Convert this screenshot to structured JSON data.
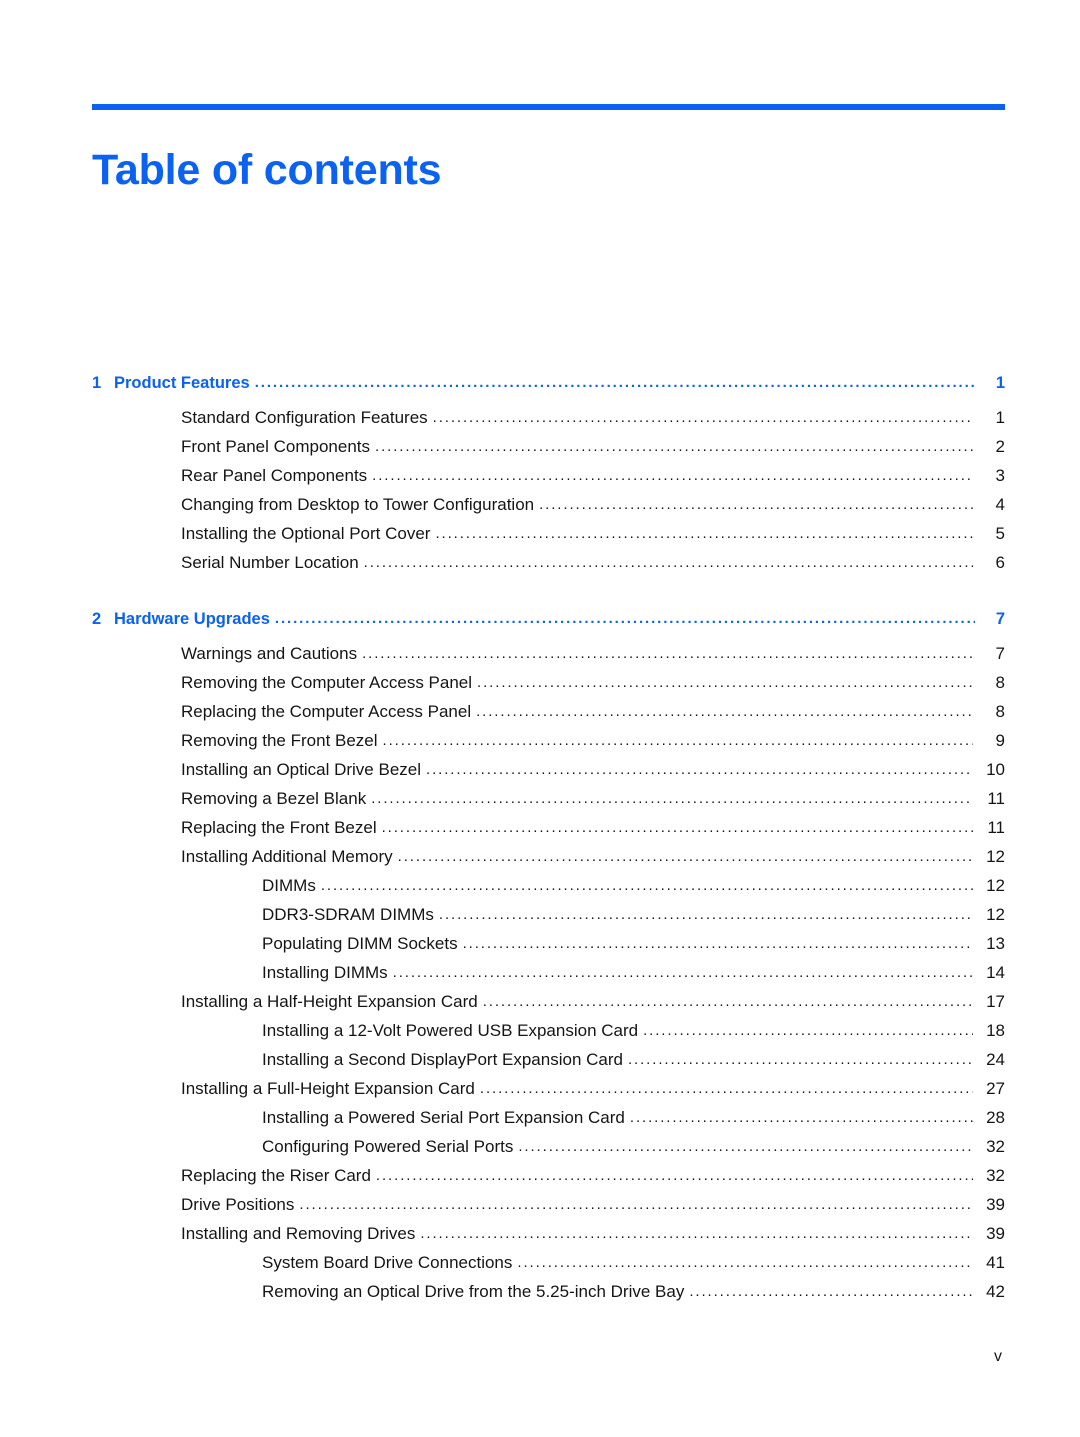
{
  "document": {
    "title": "Table of contents",
    "accent_color": "#0a62ef",
    "text_color": "#151515",
    "folio": "v"
  },
  "toc": {
    "leader_char": "............................................................................................................................................................................",
    "entries": [
      {
        "level": 1,
        "number": "1",
        "label": "Product Features",
        "page": "1"
      },
      {
        "level": 2,
        "number": "",
        "label": "Standard Configuration Features",
        "page": "1"
      },
      {
        "level": 2,
        "number": "",
        "label": "Front Panel Components",
        "page": "2"
      },
      {
        "level": 2,
        "number": "",
        "label": "Rear Panel Components",
        "page": "3"
      },
      {
        "level": 2,
        "number": "",
        "label": "Changing from Desktop to Tower Configuration",
        "page": "4"
      },
      {
        "level": 2,
        "number": "",
        "label": "Installing the Optional Port Cover",
        "page": "5"
      },
      {
        "level": 2,
        "number": "",
        "label": "Serial Number Location",
        "page": "6"
      },
      {
        "level": 1,
        "number": "2",
        "label": "Hardware Upgrades",
        "page": "7"
      },
      {
        "level": 2,
        "number": "",
        "label": "Warnings and Cautions",
        "page": "7"
      },
      {
        "level": 2,
        "number": "",
        "label": "Removing the Computer Access Panel",
        "page": "8"
      },
      {
        "level": 2,
        "number": "",
        "label": "Replacing the Computer Access Panel",
        "page": "8"
      },
      {
        "level": 2,
        "number": "",
        "label": "Removing the Front Bezel",
        "page": "9"
      },
      {
        "level": 2,
        "number": "",
        "label": "Installing an Optical Drive Bezel",
        "page": "10"
      },
      {
        "level": 2,
        "number": "",
        "label": "Removing a Bezel Blank",
        "page": "11"
      },
      {
        "level": 2,
        "number": "",
        "label": "Replacing the Front Bezel",
        "page": "11"
      },
      {
        "level": 2,
        "number": "",
        "label": "Installing Additional Memory",
        "page": "12"
      },
      {
        "level": 3,
        "number": "",
        "label": "DIMMs",
        "page": "12"
      },
      {
        "level": 3,
        "number": "",
        "label": "DDR3-SDRAM DIMMs",
        "page": "12"
      },
      {
        "level": 3,
        "number": "",
        "label": "Populating DIMM Sockets",
        "page": "13"
      },
      {
        "level": 3,
        "number": "",
        "label": "Installing DIMMs",
        "page": "14"
      },
      {
        "level": 2,
        "number": "",
        "label": "Installing a Half-Height Expansion Card",
        "page": "17"
      },
      {
        "level": 3,
        "number": "",
        "label": "Installing a 12-Volt Powered USB Expansion Card",
        "page": "18"
      },
      {
        "level": 3,
        "number": "",
        "label": "Installing a Second DisplayPort Expansion Card",
        "page": "24"
      },
      {
        "level": 2,
        "number": "",
        "label": "Installing a Full-Height Expansion Card",
        "page": "27"
      },
      {
        "level": 3,
        "number": "",
        "label": "Installing a Powered Serial Port Expansion Card",
        "page": "28"
      },
      {
        "level": 3,
        "number": "",
        "label": "Configuring Powered Serial Ports",
        "page": "32"
      },
      {
        "level": 2,
        "number": "",
        "label": "Replacing the Riser Card",
        "page": "32"
      },
      {
        "level": 2,
        "number": "",
        "label": "Drive Positions",
        "page": "39"
      },
      {
        "level": 2,
        "number": "",
        "label": "Installing and Removing Drives",
        "page": "39"
      },
      {
        "level": 3,
        "number": "",
        "label": "System Board Drive Connections",
        "page": "41"
      },
      {
        "level": 3,
        "number": "",
        "label": "Removing an Optical Drive from the 5.25-inch Drive Bay",
        "page": "42"
      }
    ]
  }
}
